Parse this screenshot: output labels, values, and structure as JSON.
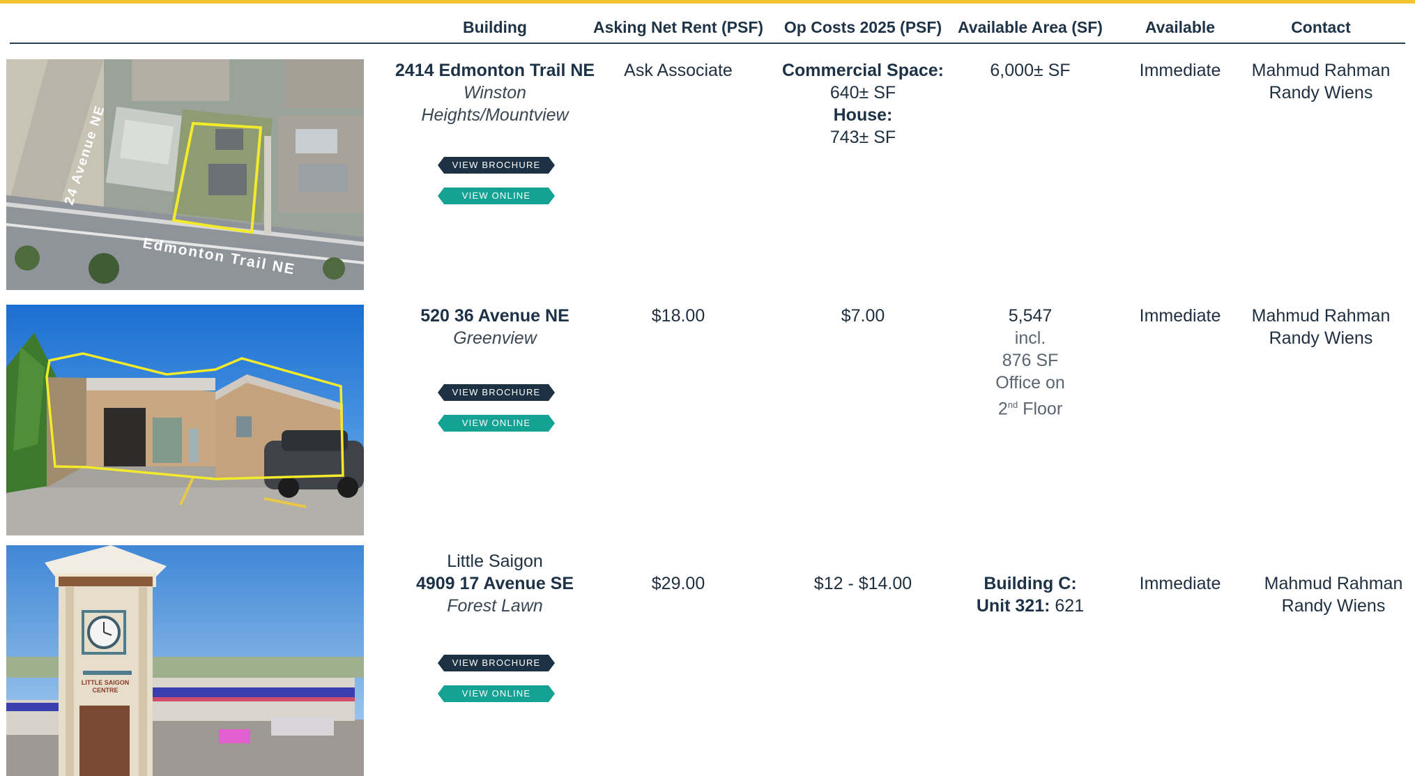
{
  "headers": {
    "building": "Building",
    "rent": "Asking Net Rent (PSF)",
    "opcosts": "Op Costs 2025 (PSF)",
    "area": "Available Area (SF)",
    "available": "Available",
    "contact": "Contact"
  },
  "buttons": {
    "brochure": "VIEW BROCHURE",
    "online": "VIEW ONLINE"
  },
  "listings": [
    {
      "address": "2414 Edmonton Trail NE",
      "neighbourhood": "Winston Heights/Mountview",
      "rent": "Ask Associate",
      "opcosts": {
        "label1": "Commercial Space:",
        "value1": "640± SF",
        "label2": "House:",
        "value2": "743± SF"
      },
      "area": "6,000± SF",
      "available": "Immediate",
      "contacts": [
        "Mahmud Rahman",
        "Randy Wiens"
      ],
      "map_labels": {
        "street1": "24 Avenue NE",
        "street2": "Edmonton Trail NE"
      }
    },
    {
      "address": "520 36 Avenue NE",
      "neighbourhood": "Greenview",
      "rent": "$18.00",
      "opcosts": "$7.00",
      "area": {
        "total": "5,547",
        "line2": "incl.",
        "line3": "876 SF",
        "line4": "Office on",
        "line5_num": "2",
        "line5_sup": "nd",
        "line5_rest": " Floor"
      },
      "available": "Immediate",
      "contacts": [
        "Mahmud Rahman",
        "Randy Wiens"
      ]
    },
    {
      "name": "Little Saigon",
      "address": "4909 17 Avenue SE",
      "neighbourhood": "Forest Lawn",
      "rent": "$29.00",
      "opcosts": "$12 - $14.00",
      "area": {
        "label1": "Building C:",
        "label2": "Unit 321:",
        "value": " 621"
      },
      "available": "Immediate",
      "contacts": [
        "Mahmud Rahman",
        "Randy Wiens"
      ],
      "sign_text": {
        "line1": "LITTLE SAIGON",
        "line2": "CENTRE"
      }
    }
  ],
  "colors": {
    "accent_gold": "#f2c22f",
    "navy": "#1d3144",
    "teal": "#14a294",
    "highlight_yellow": "#f2ea2a"
  }
}
